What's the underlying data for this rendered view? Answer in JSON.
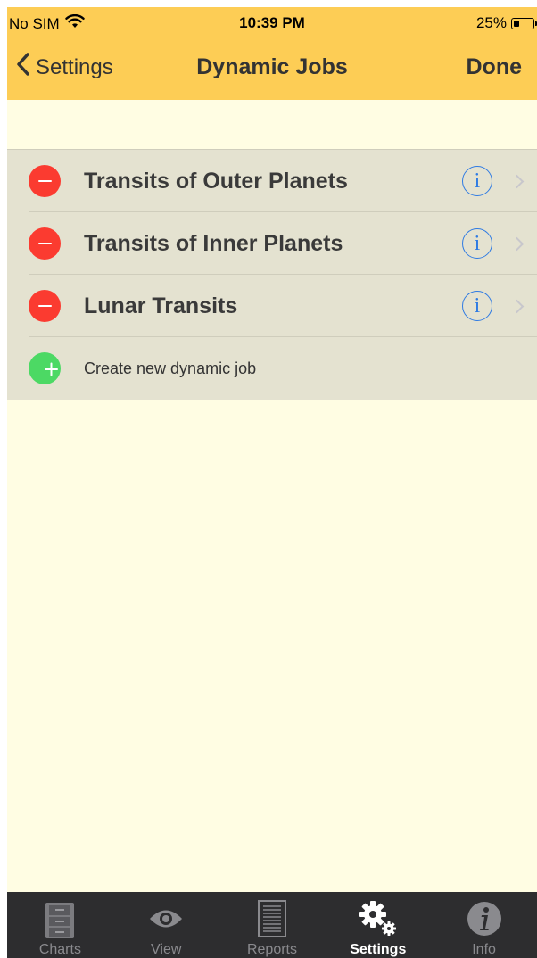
{
  "status_bar": {
    "carrier": "No SIM",
    "time": "10:39 PM",
    "battery": "25%"
  },
  "nav": {
    "back_label": "Settings",
    "title": "Dynamic Jobs",
    "done_label": "Done"
  },
  "jobs": [
    {
      "label": "Transits of Outer Planets"
    },
    {
      "label": "Transits of Inner Planets"
    },
    {
      "label": "Lunar Transits"
    }
  ],
  "create_label": "Create new dynamic job",
  "info_glyph": "i",
  "tabs": [
    {
      "label": "Charts",
      "icon": "cabinet-icon",
      "active": false
    },
    {
      "label": "View",
      "icon": "eye-icon",
      "active": false
    },
    {
      "label": "Reports",
      "icon": "document-icon",
      "active": false
    },
    {
      "label": "Settings",
      "icon": "gears-icon",
      "active": true
    },
    {
      "label": "Info",
      "icon": "info-icon",
      "active": false
    }
  ],
  "colors": {
    "nav_bar": "#fdcd55",
    "background": "#fffde3",
    "list_background": "#e4e2d0",
    "delete": "#fb3b30",
    "add": "#4cd964",
    "info": "#2f7be3",
    "tab_bar": "#2d2d2f"
  }
}
